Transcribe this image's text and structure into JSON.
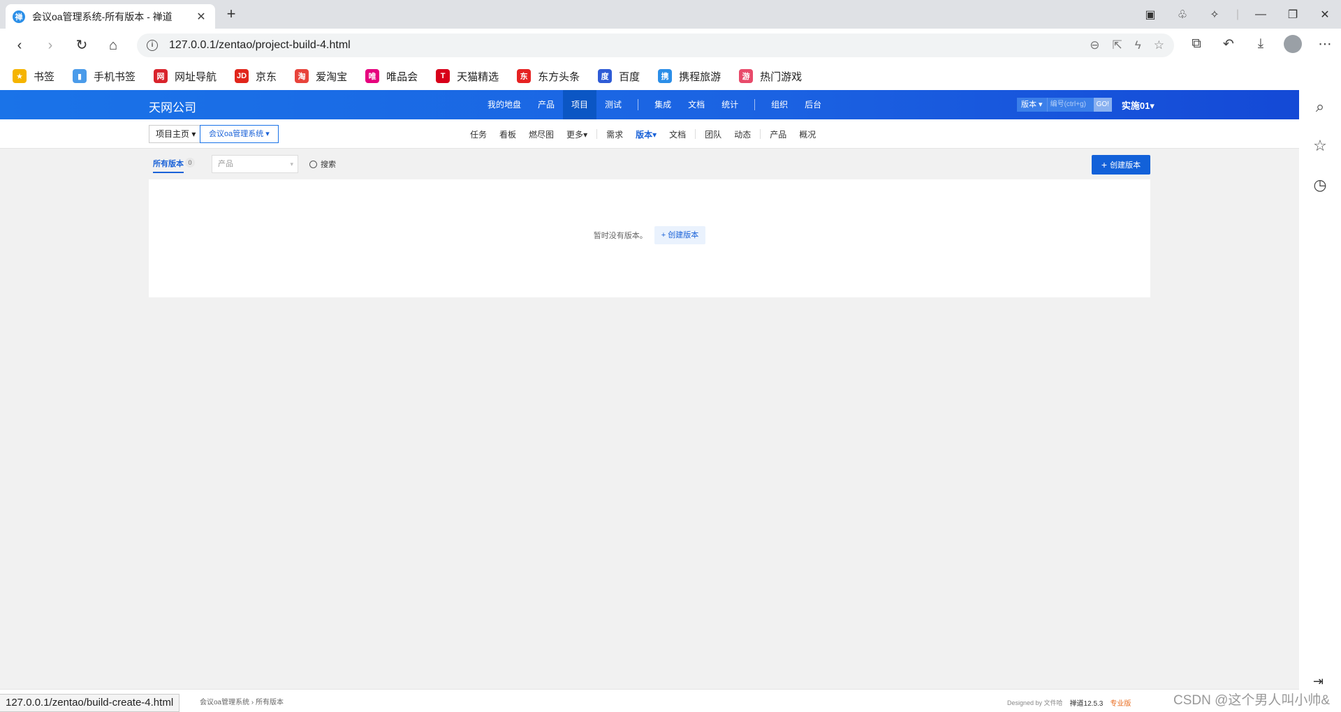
{
  "browser": {
    "tab_title": "会议oa管理系统-所有版本 - 禅道",
    "url": "127.0.0.1/zentao/project-build-4.html",
    "status_url": "127.0.0.1/zentao/build-create-4.html"
  },
  "bookmarks": [
    {
      "label": "书签",
      "icon": "star-icon",
      "color": "#f5b400",
      "glyph": "★"
    },
    {
      "label": "手机书签",
      "icon": "phone-icon",
      "color": "#4a9bea",
      "glyph": "▮"
    },
    {
      "label": "网址导航",
      "icon": "nav-icon",
      "color": "#d9232c",
      "glyph": "网"
    },
    {
      "label": "京东",
      "icon": "jd-icon",
      "color": "#e1251b",
      "glyph": "JD"
    },
    {
      "label": "爱淘宝",
      "icon": "taobao-icon",
      "color": "#e8433b",
      "glyph": "淘"
    },
    {
      "label": "唯品会",
      "icon": "vip-icon",
      "color": "#e6007e",
      "glyph": "唯"
    },
    {
      "label": "天猫精选",
      "icon": "tmall-icon",
      "color": "#d8001a",
      "glyph": "T"
    },
    {
      "label": "东方头条",
      "icon": "dftt-icon",
      "color": "#e62222",
      "glyph": "东"
    },
    {
      "label": "百度",
      "icon": "baidu-icon",
      "color": "#2e5bd6",
      "glyph": "度"
    },
    {
      "label": "携程旅游",
      "icon": "ctrip-icon",
      "color": "#2b8ee8",
      "glyph": "携"
    },
    {
      "label": "热门游戏",
      "icon": "game-icon",
      "color": "#e84a6a",
      "glyph": "游"
    }
  ],
  "header": {
    "company": "天网公司",
    "nav": [
      "我的地盘",
      "产品",
      "项目",
      "测试",
      "集成",
      "文档",
      "统计",
      "组织",
      "后台"
    ],
    "active_nav": "项目",
    "version_label": "版本",
    "search_placeholder": "编号(ctrl+g)",
    "go_label": "GO!",
    "user": "实施01"
  },
  "subnav": {
    "crumb_home": "项目主页",
    "crumb_project": "会议oa管理系统",
    "items": [
      "任务",
      "看板",
      "燃尽图",
      "更多",
      "需求",
      "版本",
      "文档",
      "团队",
      "动态",
      "产品",
      "概况"
    ],
    "active": "版本"
  },
  "featurebar": {
    "tab_label": "所有版本",
    "tab_count": "0",
    "product_placeholder": "产品",
    "search_label": "搜索",
    "create_label": "创建版本"
  },
  "empty": {
    "text": "暂时没有版本。",
    "button": "创建版本"
  },
  "footer": {
    "path": [
      "会议oa管理系统",
      "所有版本"
    ],
    "designed_by": "Designed by 文件哈",
    "version": "禅道12.5.3",
    "edition": "专业版"
  },
  "watermark": "CSDN @这个男人叫小帅&",
  "colors": {
    "brand": "#1a73e8",
    "primary_button": "#1261d9",
    "background": "#f1f1f1"
  }
}
